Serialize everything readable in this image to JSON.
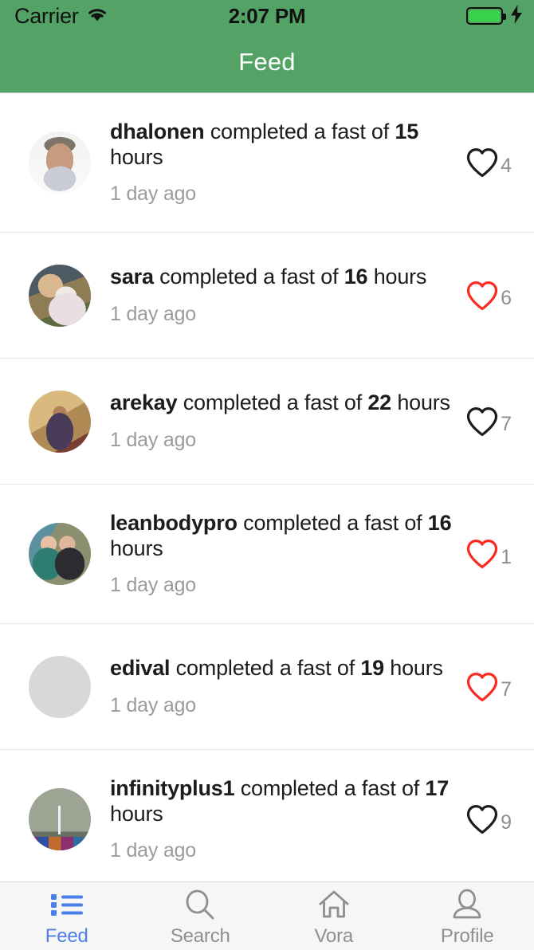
{
  "status_bar": {
    "carrier": "Carrier",
    "time": "2:07 PM",
    "wifi_icon": "wifi-icon",
    "battery_icon": "battery-icon",
    "charging_icon": "lightning-bolt-icon",
    "battery_level_percent": 100
  },
  "nav_bar": {
    "title": "Feed",
    "background_color": "#52a365",
    "title_color": "#ffffff"
  },
  "feed": {
    "action_text": "completed a fast of",
    "hours_label": "hours",
    "items": [
      {
        "username": "dhalonen",
        "action": "completed a fast of",
        "hours": "15",
        "hours_label": "hours",
        "time_ago": "1 day ago",
        "like_count": "4",
        "liked": false,
        "heart_color": "#1c1c1c",
        "avatar": "ph-dhalonen",
        "height": "tall"
      },
      {
        "username": "sara",
        "action": "completed a fast of",
        "hours": "16",
        "hours_label": "hours",
        "time_ago": "1 day ago",
        "like_count": "6",
        "liked": true,
        "heart_color": "#fa2a1e",
        "avatar": "ph-sara",
        "height": "short"
      },
      {
        "username": "arekay",
        "action": "completed a fast of",
        "hours": "22",
        "hours_label": "hours",
        "time_ago": "1 day ago",
        "like_count": "7",
        "liked": false,
        "heart_color": "#1c1c1c",
        "avatar": "ph-arekay",
        "height": "short"
      },
      {
        "username": "leanbodypro",
        "action": "completed a fast of",
        "hours": "16",
        "hours_label": "hours",
        "time_ago": "1 day ago",
        "like_count": "1",
        "liked": true,
        "heart_color": "#fa2a1e",
        "avatar": "ph-leanbodypro",
        "height": "tall"
      },
      {
        "username": "edival",
        "action": "completed a fast of",
        "hours": "19",
        "hours_label": "hours",
        "time_ago": "1 day ago",
        "like_count": "7",
        "liked": true,
        "heart_color": "#fa2a1e",
        "avatar": "ph-edival",
        "height": "short"
      },
      {
        "username": "infinityplus1",
        "action": "completed a fast of",
        "hours": "17",
        "hours_label": "hours",
        "time_ago": "1 day ago",
        "like_count": "9",
        "liked": false,
        "heart_color": "#1c1c1c",
        "avatar": "ph-infinityplus1",
        "height": "tall"
      }
    ]
  },
  "tab_bar": {
    "active_color": "#4a7fe8",
    "inactive_color": "#8e8e93",
    "items": [
      {
        "label": "Feed",
        "icon": "list-icon",
        "active": true
      },
      {
        "label": "Search",
        "icon": "search-icon",
        "active": false
      },
      {
        "label": "Vora",
        "icon": "home-icon",
        "active": false
      },
      {
        "label": "Profile",
        "icon": "person-icon",
        "active": false
      }
    ]
  }
}
